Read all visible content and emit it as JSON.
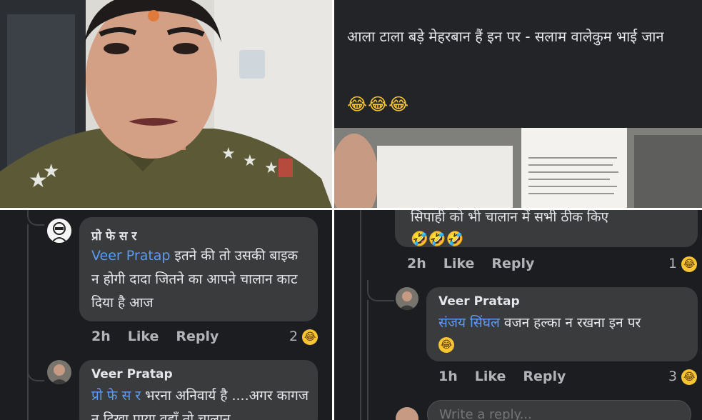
{
  "post": {
    "text": "आला टाला बड़े मेहरबान हैं इन पर - सलाम वालेकुम भाई जान",
    "emoji": "😂😂😂"
  },
  "left_comments": [
    {
      "name": "प्रो फे स र",
      "mention": "Veer Pratap",
      "text": " इतने की तो उसकी बाइक न होगी दादा जितने का आपने चालान काट दिया है आज",
      "time": "2h",
      "like": "Like",
      "reply": "Reply",
      "reactions": "2"
    },
    {
      "name": "Veer Pratap",
      "mention": "प्रो फे स र",
      "text": " भरना अनिवार्य है ....अगर कागज न दिखा पाया वहाँ तो चालान"
    }
  ],
  "right_comments": [
    {
      "top_text": "सिपाही को भी चालान में सभी ठीक किए",
      "emoji": "🤣🤣🤣",
      "time": "2h",
      "like": "Like",
      "reply": "Reply",
      "reactions": "1"
    },
    {
      "name": "Veer Pratap",
      "mention": "संजय सिंघल",
      "text": " वजन हल्का न रखना इन पर",
      "emoji": "😂",
      "time": "1h",
      "like": "Like",
      "reply": "Reply",
      "reactions": "3"
    }
  ],
  "reply_input": {
    "placeholder": "Write a reply..."
  }
}
